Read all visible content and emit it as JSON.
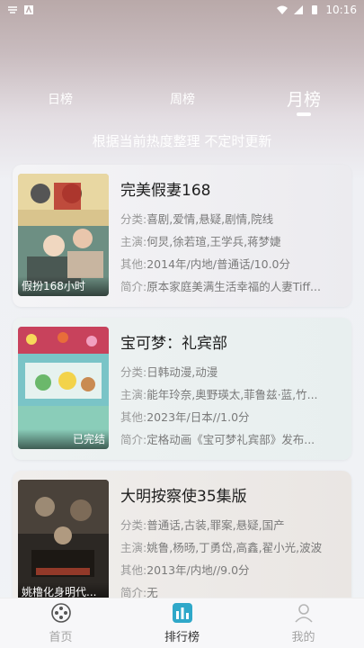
{
  "statusbar": {
    "time": "10:16"
  },
  "tabs": [
    {
      "label": "日榜"
    },
    {
      "label": "周榜"
    },
    {
      "label": "月榜"
    }
  ],
  "subtitle": "根据当前热度整理 不定时更新",
  "labels": {
    "category": "分类:",
    "cast": "主演:",
    "other": "其他:",
    "summary": "简介:"
  },
  "items": [
    {
      "title": "完美假妻168",
      "poster_caption": "假扮168小时",
      "category": "喜剧,爱情,悬疑,剧情,院线",
      "cast": "何炅,徐若瑄,王学兵,蒋梦婕",
      "other": "2014年/内地/普通话/10.0分",
      "summary": "原本家庭美满生活幸福的人妻Tiff..."
    },
    {
      "title": "宝可梦：礼宾部",
      "poster_caption": "已完结",
      "category": "日韩动漫,动漫",
      "cast": "能年玲奈,奥野瑛太,菲鲁兹·蓝,竹...",
      "other": "2023年/日本//1.0分",
      "summary": "定格动画《宝可梦礼宾部》发布..."
    },
    {
      "title": "大明按察使35集版",
      "poster_caption": "姚橹化身明代...",
      "category": "普通话,古装,罪案,悬疑,国产",
      "cast": "姚鲁,杨旸,丁勇岱,高鑫,翟小光,波波",
      "other": "2013年/内地//9.0分",
      "summary": "无"
    }
  ],
  "nav": [
    {
      "label": "首页",
      "icon": "film-reel-icon"
    },
    {
      "label": "排行榜",
      "icon": "ranking-chart-icon"
    },
    {
      "label": "我的",
      "icon": "profile-icon"
    }
  ]
}
